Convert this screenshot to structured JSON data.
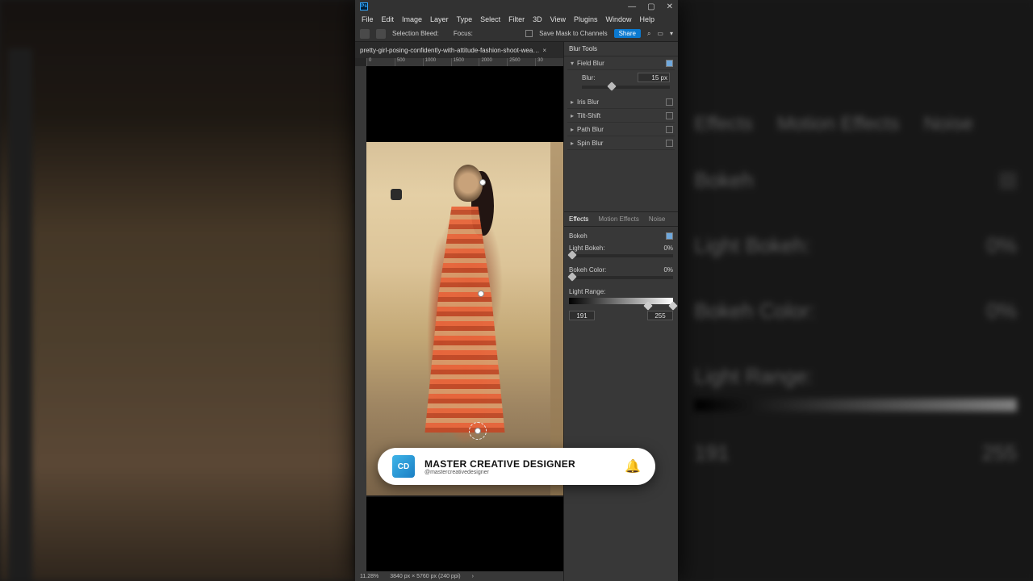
{
  "bg_right": {
    "tabs": [
      "Effects",
      "Motion Effects",
      "Noise"
    ],
    "bokeh": "Bokeh",
    "light_bokeh_label": "Light Bokeh:",
    "light_bokeh_value": "0%",
    "bokeh_color_label": "Bokeh Color:",
    "bokeh_color_value": "0%",
    "light_range_label": "Light Range:",
    "range_low": "191",
    "range_high": "255"
  },
  "menubar": [
    "File",
    "Edit",
    "Image",
    "Layer",
    "Type",
    "Select",
    "Filter",
    "3D",
    "View",
    "Plugins",
    "Window",
    "Help"
  ],
  "optbar": {
    "selection_bleed": "Selection Bleed:",
    "focus": "Focus:",
    "save_mask": "Save Mask to Channels",
    "share": "Share"
  },
  "tab": {
    "filename": "pretty-girl-posing-confidently-with-attitude-fashion-shoot-wea…",
    "close": "×",
    "chev": "»"
  },
  "ruler_marks": [
    "0",
    "500",
    "1000",
    "1500",
    "2000",
    "2500",
    "30"
  ],
  "status": {
    "zoom": "11.28%",
    "dims": "3840 px × 5760 px (240 ppi)"
  },
  "panels": {
    "blur_tools_title": "Blur Tools",
    "blur_tools": [
      {
        "name": "Field Blur",
        "expanded": true,
        "checked": true
      },
      {
        "name": "Iris Blur",
        "expanded": false,
        "checked": false
      },
      {
        "name": "Tilt-Shift",
        "expanded": false,
        "checked": false
      },
      {
        "name": "Path Blur",
        "expanded": false,
        "checked": false
      },
      {
        "name": "Spin Blur",
        "expanded": false,
        "checked": false
      }
    ],
    "field_blur": {
      "label": "Blur:",
      "value": "15 px",
      "slider_pct": 30
    },
    "effects_tabs": [
      "Effects",
      "Motion Effects",
      "Noise"
    ],
    "bokeh_label": "Bokeh",
    "bokeh_checked": true,
    "light_bokeh": {
      "label": "Light Bokeh:",
      "value": "0%"
    },
    "bokeh_color": {
      "label": "Bokeh Color:",
      "value": "0%"
    },
    "light_range": {
      "label": "Light Range:",
      "low": "191",
      "high": "255"
    }
  },
  "overlay": {
    "title": "MASTER CREATIVE DESIGNER",
    "handle": "@mastercreativedesigner",
    "logo": "CD"
  }
}
